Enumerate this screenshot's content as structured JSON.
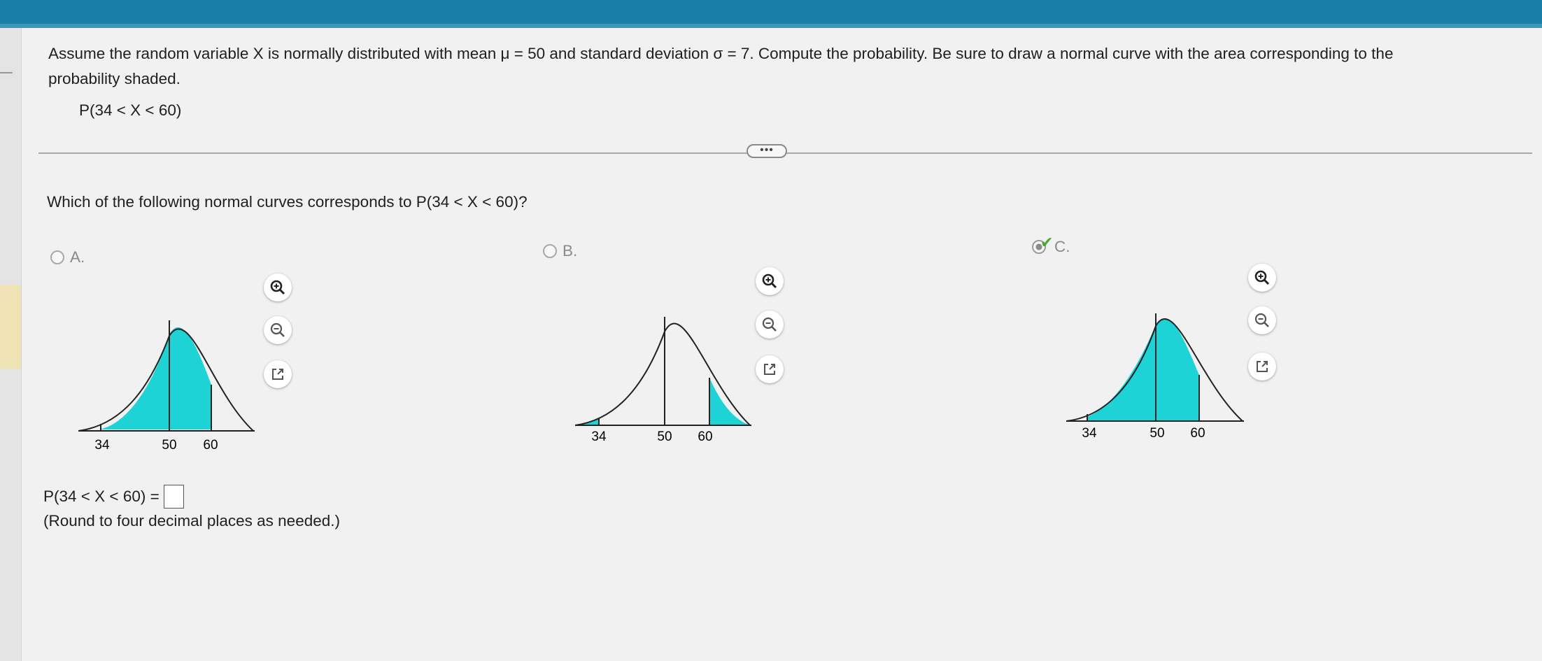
{
  "question": {
    "line1": "Assume the random variable X is normally distributed with mean μ = 50 and standard deviation σ = 7. Compute the probability. Be sure to draw a normal curve with the area corresponding to the",
    "line2": "probability shaded.",
    "probability": "P(34 < X < 60)"
  },
  "more_button": "•••",
  "subquestion": "Which of the following normal curves corresponds to P(34 < X < 60)?",
  "options": [
    {
      "label": "A.",
      "selected": false,
      "shading": "left-to-upper",
      "ticks": [
        "34",
        "50",
        "60"
      ]
    },
    {
      "label": "B.",
      "selected": false,
      "shading": "tails",
      "ticks": [
        "34",
        "50",
        "60"
      ]
    },
    {
      "label": "C.",
      "selected": true,
      "correct": true,
      "shading": "between",
      "ticks": [
        "34",
        "50",
        "60"
      ]
    }
  ],
  "check_mark": "✔",
  "answer": {
    "label": "P(34 < X < 60) =",
    "value": "",
    "note": "(Round to four decimal places as needed.)"
  },
  "colors": {
    "shade": "#1ed3d6",
    "topbar": "#1a7fa6",
    "check": "#4aa832"
  },
  "icons": [
    "zoom-in-icon",
    "zoom-out-icon",
    "open-external-icon"
  ]
}
